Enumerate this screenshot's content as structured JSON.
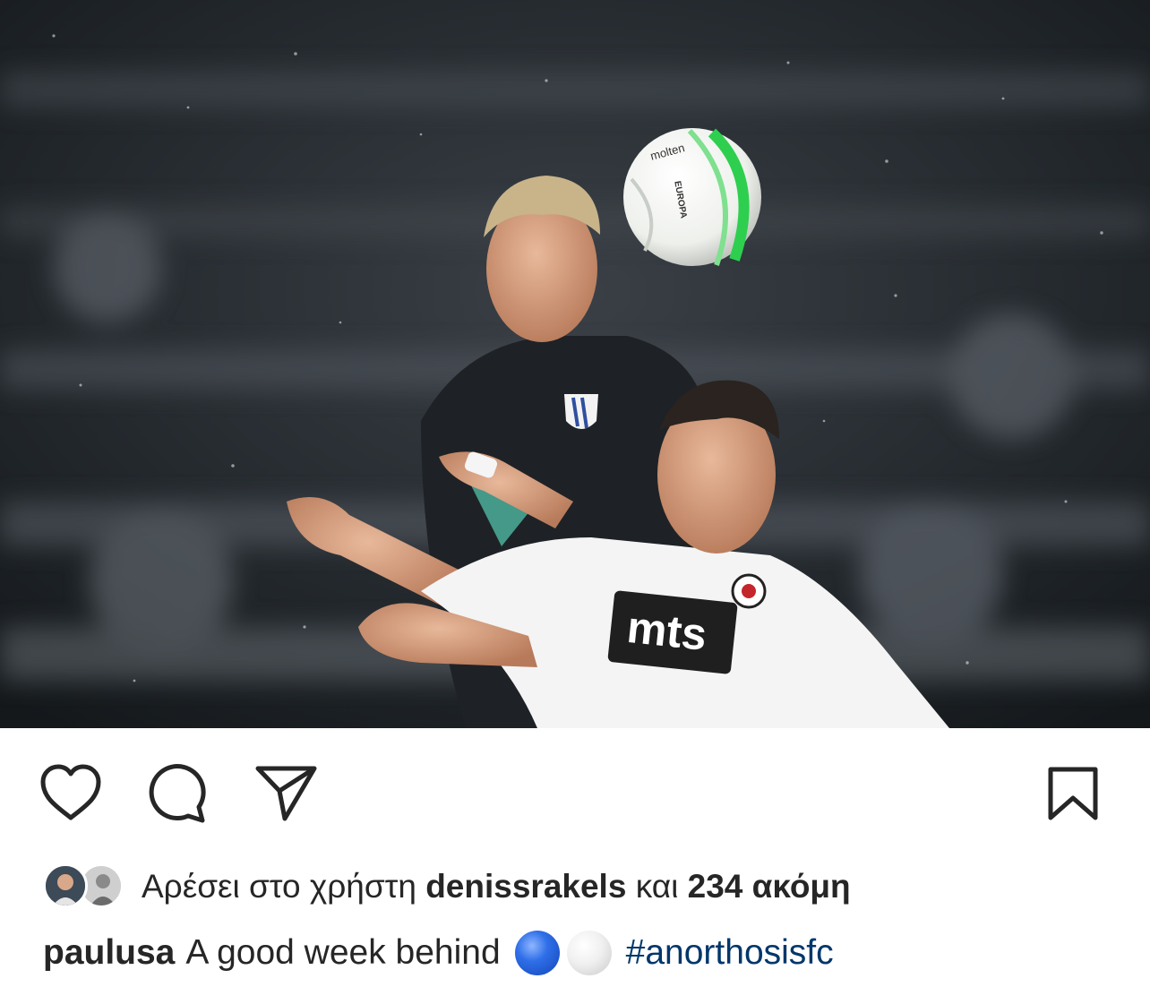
{
  "photo": {
    "ball_brand": "molten",
    "jersey_sponsor": "mts",
    "ball_label": "EUROPA"
  },
  "actions": {
    "like_icon": "heart-icon",
    "comment_icon": "comment-icon",
    "share_icon": "paper-plane-icon",
    "save_icon": "bookmark-icon"
  },
  "likes": {
    "prefix": "Αρέσει στο χρήστη",
    "user": "denissrakels",
    "connector": "και",
    "count_text": "234 ακόμη"
  },
  "caption": {
    "username": "paulusa",
    "text": "A good week behind",
    "emoji": [
      "blue-circle",
      "white-circle"
    ],
    "hashtag": "#anorthosisfc"
  },
  "colors": {
    "text": "#262626",
    "hashtag": "#00376b",
    "background": "#ffffff"
  }
}
